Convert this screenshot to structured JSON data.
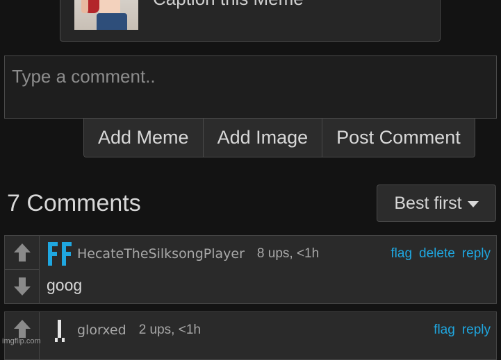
{
  "meme": {
    "caption": "Caption this Meme",
    "thumbnail_icon": "meme-thumbnail"
  },
  "composer": {
    "placeholder": "Type a comment..",
    "buttons": [
      "Add Meme",
      "Add Image",
      "Post Comment"
    ]
  },
  "comments_header": {
    "count_label": "7 Comments",
    "sort_label": "Best first",
    "sort_icon": "caret-down-icon"
  },
  "comments": [
    {
      "username": "HecateTheSilksongPlayer",
      "meta": "8 ups, <1h",
      "actions": [
        "flag",
        "delete",
        "reply"
      ],
      "text": "goog",
      "avatar_icon": "ff-avatar",
      "avatar_color": "#1fa7e0"
    },
    {
      "username": "glorxed",
      "meta": "2 ups, <1h",
      "actions": [
        "flag",
        "reply"
      ],
      "text": "",
      "avatar_icon": "figure-avatar",
      "avatar_color": "#e6e6e6"
    }
  ],
  "colors": {
    "background": "#131313",
    "panel": "#2a2a2a",
    "link": "#1fa7e0",
    "text": "#d8d8d8"
  },
  "watermark": "imgflip.com"
}
